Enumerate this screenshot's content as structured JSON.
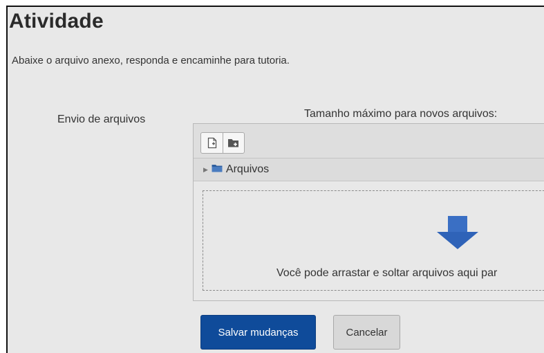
{
  "page": {
    "title": "Atividade",
    "intro": "Abaixe o arquivo anexo, responda e encaminhe para tutoria."
  },
  "upload": {
    "field_label": "Envio de arquivos",
    "max_size_text": "Tamanho máximo para novos arquivos:",
    "toolbar": {
      "buttons": [
        {
          "icon": "add-file-icon"
        },
        {
          "icon": "create-folder-icon"
        }
      ]
    },
    "path": {
      "label": "Arquivos",
      "icon": "folder-icon"
    },
    "dropzone": {
      "text": "Você pode arrastar e soltar arquivos aqui par",
      "icon": "arrow-down-icon"
    }
  },
  "actions": {
    "save_label": "Salvar mudanças",
    "cancel_label": "Cancelar"
  },
  "colors": {
    "primary_button": "#0f4b9a",
    "background": "#e8e8e8",
    "arrow": "#3a6fc4"
  }
}
